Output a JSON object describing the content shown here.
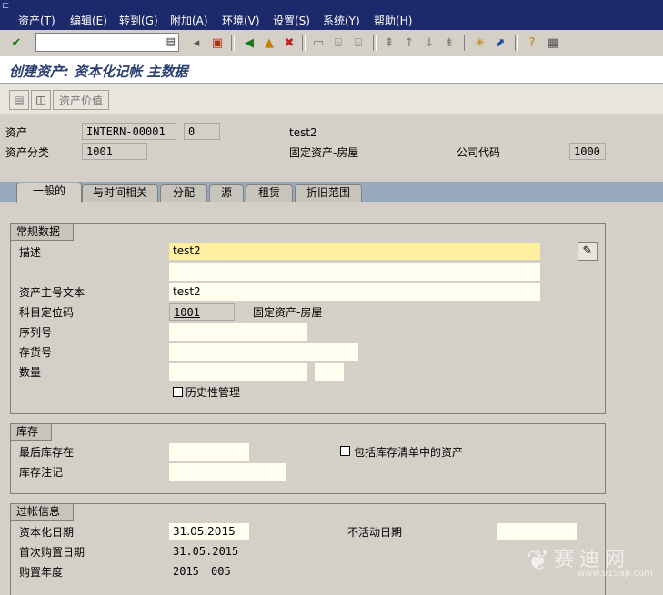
{
  "menu": [
    "资产(T)",
    "编辑(E)",
    "转到(G)",
    "附加(A)",
    "环境(V)",
    "设置(S)",
    "系统(Y)",
    "帮助(H)"
  ],
  "command_field": {
    "value": ""
  },
  "title": "创建资产: 资本化记帐 主数据",
  "app_toolbar": {
    "asset_values_label": "资产价值"
  },
  "header": {
    "asset_label": "资产",
    "asset_number": "INTERN-00001",
    "asset_sub_number": "0",
    "asset_desc": "test2",
    "asset_class_label": "资产分类",
    "asset_class": "1001",
    "asset_class_desc": "固定资产-房屋",
    "company_code_label": "公司代码",
    "company_code": "1000"
  },
  "tabs": [
    "一般的",
    "与时间相关",
    "分配",
    "源",
    "租赁",
    "折旧范围"
  ],
  "general": {
    "title": "常规数据",
    "description_label": "描述",
    "description_value": "test2",
    "description2_value": "",
    "main_text_label": "资产主号文本",
    "main_text_value": "test2",
    "account_det_label": "科目定位码",
    "account_det_value": "1001",
    "account_det_desc": "固定资产-房屋",
    "serial_label": "序列号",
    "serial_value": "",
    "inventory_no_label": "存货号",
    "inventory_no_value": "",
    "quantity_label": "数量",
    "quantity_value": "",
    "quantity_unit": "",
    "history_label": "历史性管理"
  },
  "inventory": {
    "title": "库存",
    "last_inventory_label": "最后库存在",
    "last_inventory_value": "",
    "include_list_label": "包括库存清单中的资产",
    "inventory_note_label": "库存注记",
    "inventory_note_value": ""
  },
  "posting": {
    "title": "过帐信息",
    "cap_date_label": "资本化日期",
    "cap_date_value": "31.05.2015",
    "inactive_date_label": "不活动日期",
    "inactive_date_value": "",
    "first_acq_label": "首次购置日期",
    "first_acq_value": "31.05.2015",
    "acq_year_label": "购置年度",
    "acq_year_value": "2015",
    "acq_period_value": "005"
  },
  "watermark": {
    "text": "赛迪网",
    "url": "www.91Sap.com"
  },
  "colors": {
    "menubar": "#1c2a6b",
    "tabstrip": "#99aabd",
    "focus_field": "#fff0a0",
    "title": "#2a3e72"
  }
}
